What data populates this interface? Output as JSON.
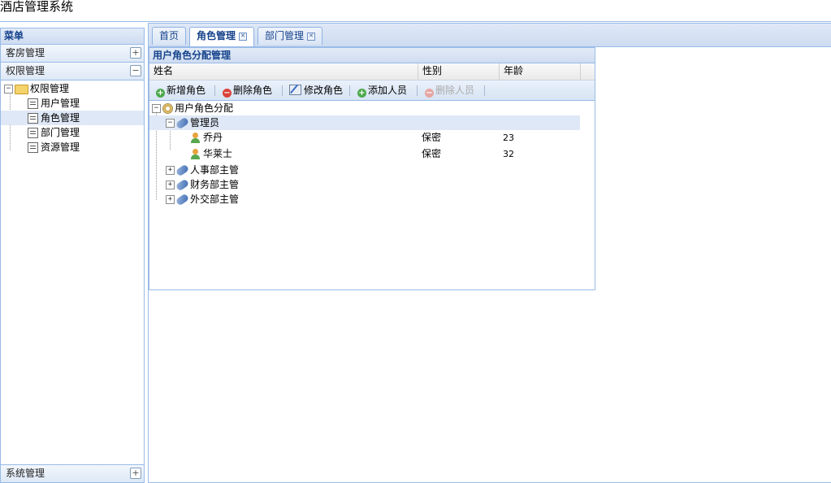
{
  "app": {
    "title": "酒店管理系统"
  },
  "west": {
    "header": "菜单",
    "sections": [
      {
        "label": "客房管理",
        "tool": "+"
      },
      {
        "label": "权限管理",
        "tool": "−"
      }
    ],
    "bottom_section": {
      "label": "系统管理",
      "tool": "+"
    },
    "tree": {
      "root": {
        "label": "权限管理",
        "toggle": "−"
      },
      "items": [
        {
          "label": "用户管理",
          "selected": false
        },
        {
          "label": "角色管理",
          "selected": true
        },
        {
          "label": "部门管理",
          "selected": false
        },
        {
          "label": "资源管理",
          "selected": false
        }
      ]
    }
  },
  "tabs": [
    {
      "label": "首页",
      "closable": false,
      "active": false
    },
    {
      "label": "角色管理",
      "closable": true,
      "active": true
    },
    {
      "label": "部门管理",
      "closable": true,
      "active": false
    }
  ],
  "grid": {
    "title": "用户角色分配管理",
    "columns": [
      "姓名",
      "性别",
      "年龄"
    ],
    "toolbar": [
      {
        "label": "新增角色",
        "icon": "add-icon",
        "disabled": false
      },
      {
        "label": "删除角色",
        "icon": "delete-icon",
        "disabled": false
      },
      {
        "label": "修改角色",
        "icon": "edit-icon",
        "disabled": false
      },
      {
        "label": "添加人员",
        "icon": "add-icon",
        "disabled": false
      },
      {
        "label": "删除人员",
        "icon": "delete-icon",
        "disabled": true
      }
    ],
    "tree": {
      "root": {
        "label": "用户角色分配",
        "toggle": "−"
      },
      "groups": [
        {
          "label": "管理员",
          "toggle": "−",
          "selected": true,
          "members": [
            {
              "name": "乔丹",
              "gender": "保密",
              "age": "23"
            },
            {
              "name": "华莱士",
              "gender": "保密",
              "age": "32"
            }
          ]
        },
        {
          "label": "人事部主管",
          "toggle": "+",
          "selected": false
        },
        {
          "label": "财务部主管",
          "toggle": "+",
          "selected": false
        },
        {
          "label": "外交部主管",
          "toggle": "+",
          "selected": false
        }
      ]
    }
  }
}
